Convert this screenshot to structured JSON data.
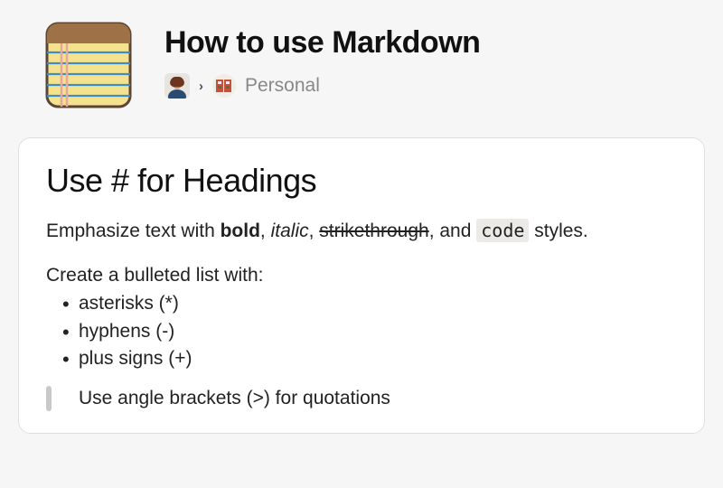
{
  "header": {
    "title": "How to use Markdown",
    "breadcrumb": {
      "space_label": "Personal"
    }
  },
  "content": {
    "heading": "Use # for Headings",
    "emphasize": {
      "prefix": "Emphasize text with ",
      "bold": "bold",
      "sep1": ", ",
      "italic": "italic",
      "sep2": ", ",
      "strike": "strikethrough",
      "sep3": ", and ",
      "code": "code",
      "suffix": " styles."
    },
    "list_intro": "Create a bulleted list with:",
    "bullets": [
      "asterisks (*)",
      "hyphens (-)",
      "plus signs (+)"
    ],
    "quote": "Use angle brackets (>) for quotations"
  }
}
